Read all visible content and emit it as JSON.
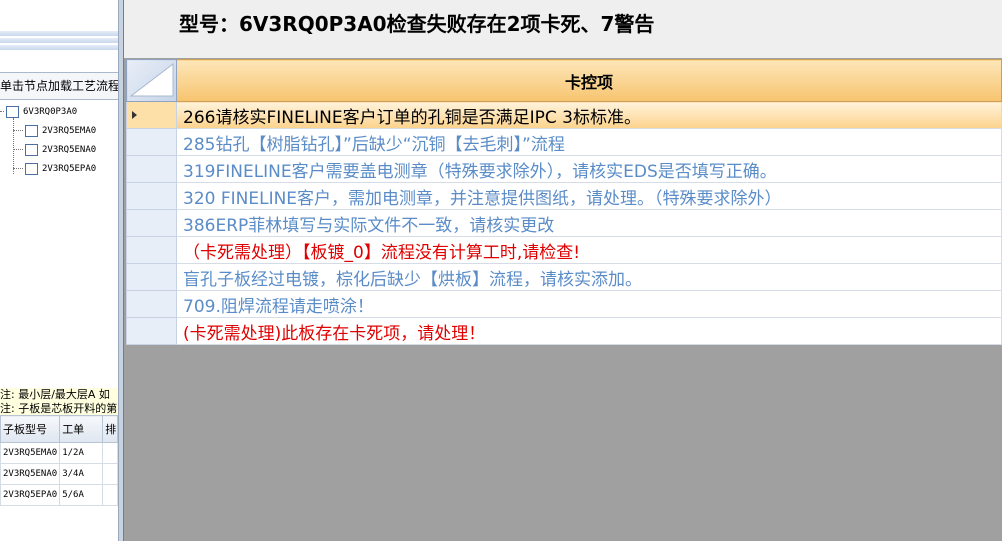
{
  "left_panel": {
    "load_flow_label": "单击节点加载工艺流程",
    "tree": {
      "root": "6V3RQ0P3A0",
      "children": [
        "2V3RQ5EMA0",
        "2V3RQ5ENA0",
        "2V3RQ5EPA0"
      ]
    },
    "note": {
      "line1": "注: 最小层/最大层A 如",
      "line2": "注: 子板是芯板开料的第"
    },
    "sub_table": {
      "headers": [
        "子板型号",
        "工单",
        "排"
      ],
      "rows": [
        [
          "2V3RQ5EMA0",
          "1/2A"
        ],
        [
          "2V3RQ5ENA0",
          "3/4A"
        ],
        [
          "2V3RQ5EPA0",
          "5/6A"
        ]
      ]
    }
  },
  "right_panel": {
    "title": "型号：6V3RQ0P3A0检查失败存在2项卡死、7警告",
    "grid_header": "卡控项",
    "rows": [
      {
        "text": "266请核实FINELINE客户订单的孔铜是否满足IPC 3标标准。",
        "color": "#000000",
        "selected": true
      },
      {
        "text": "285钻孔【树脂钻孔】”后缺少“沉铜【去毛刺】”流程",
        "color": "#5a8cc8",
        "selected": false
      },
      {
        "text": "319FINELINE客户需要盖电测章（特殊要求除外），请核实EDS是否填写正确。",
        "color": "#5a8cc8",
        "selected": false
      },
      {
        "text": "320 FINELINE客户，需加电测章，并注意提供图纸，请处理。（特殊要求除外）",
        "color": "#5a8cc8",
        "selected": false
      },
      {
        "text": "386ERP菲林填写与实际文件不一致，请核实更改",
        "color": "#5a8cc8",
        "selected": false
      },
      {
        "text": "（卡死需处理）【板镀_0】流程没有计算工时,请检查!",
        "color": "#e00000",
        "selected": false
      },
      {
        "text": "盲孔子板经过电镀，棕化后缺少【烘板】流程，请核实添加。",
        "color": "#5a8cc8",
        "selected": false
      },
      {
        "text": "709.阻焊流程请走喷涂！",
        "color": "#5a8cc8",
        "selected": false
      },
      {
        "text": "(卡死需处理)此板存在卡死项，请处理！",
        "color": "#e00000",
        "selected": false
      }
    ]
  },
  "colors": {
    "warning_text": "#5a8cc8",
    "error_text": "#e00000",
    "selected_row": "#fcd28c",
    "empty_area": "#a0a0a0"
  }
}
